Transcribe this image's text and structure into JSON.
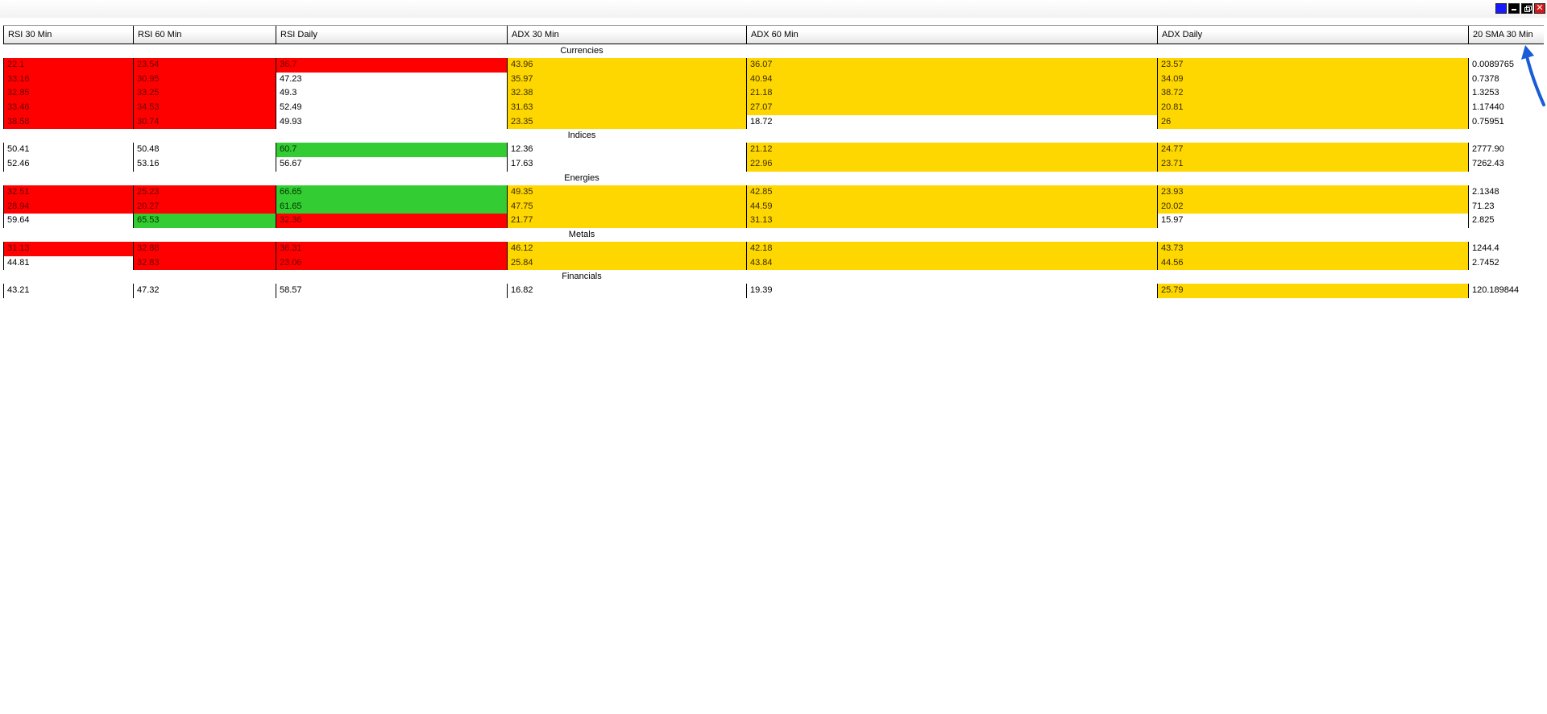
{
  "colors": {
    "red": "#ff0000",
    "green": "#33cc33",
    "yellow": "#ffd700",
    "arrow": "#1a5bd6"
  },
  "titlebar": {
    "buttons": [
      "color-swatch-icon",
      "minimize-icon",
      "restore-icon",
      "close-icon"
    ],
    "close_glyph": "✕"
  },
  "columns": [
    "RSI 30 Min",
    "RSI 60 Min",
    "RSI Daily",
    "ADX 30 Min",
    "ADX 60 Min",
    "ADX Daily",
    "20 SMA 30 Min"
  ],
  "groups": [
    {
      "name": "Currencies",
      "rows": [
        [
          {
            "v": "22.1",
            "c": "red"
          },
          {
            "v": "23.54",
            "c": "red"
          },
          {
            "v": "36.7",
            "c": "red"
          },
          {
            "v": "43.96",
            "c": "yellow"
          },
          {
            "v": "36.07",
            "c": "yellow"
          },
          {
            "v": "23.57",
            "c": "yellow"
          },
          {
            "v": "0.0089765",
            "c": "white"
          }
        ],
        [
          {
            "v": "33.16",
            "c": "red"
          },
          {
            "v": "30.95",
            "c": "red"
          },
          {
            "v": "47.23",
            "c": "white"
          },
          {
            "v": "35.97",
            "c": "yellow"
          },
          {
            "v": "40.94",
            "c": "yellow"
          },
          {
            "v": "34.09",
            "c": "yellow"
          },
          {
            "v": "0.7378",
            "c": "white"
          }
        ],
        [
          {
            "v": "32.85",
            "c": "red"
          },
          {
            "v": "33.25",
            "c": "red"
          },
          {
            "v": "49.3",
            "c": "white"
          },
          {
            "v": "32.38",
            "c": "yellow"
          },
          {
            "v": "21.18",
            "c": "yellow"
          },
          {
            "v": "38.72",
            "c": "yellow"
          },
          {
            "v": "1.3253",
            "c": "white"
          }
        ],
        [
          {
            "v": "33.46",
            "c": "red"
          },
          {
            "v": "34.53",
            "c": "red"
          },
          {
            "v": "52.49",
            "c": "white"
          },
          {
            "v": "31.63",
            "c": "yellow"
          },
          {
            "v": "27.07",
            "c": "yellow"
          },
          {
            "v": "20.81",
            "c": "yellow"
          },
          {
            "v": "1.17440",
            "c": "white"
          }
        ],
        [
          {
            "v": "38.58",
            "c": "red"
          },
          {
            "v": "30.74",
            "c": "red"
          },
          {
            "v": "49.93",
            "c": "white"
          },
          {
            "v": "23.35",
            "c": "yellow"
          },
          {
            "v": "18.72",
            "c": "white"
          },
          {
            "v": "26",
            "c": "yellow"
          },
          {
            "v": "0.75951",
            "c": "white"
          }
        ]
      ]
    },
    {
      "name": "Indices",
      "rows": [
        [
          {
            "v": "50.41",
            "c": "white"
          },
          {
            "v": "50.48",
            "c": "white"
          },
          {
            "v": "60.7",
            "c": "green"
          },
          {
            "v": "12.36",
            "c": "white"
          },
          {
            "v": "21.12",
            "c": "yellow"
          },
          {
            "v": "24.77",
            "c": "yellow"
          },
          {
            "v": "2777.90",
            "c": "white"
          }
        ],
        [
          {
            "v": "52.46",
            "c": "white"
          },
          {
            "v": "53.16",
            "c": "white"
          },
          {
            "v": "56.67",
            "c": "white"
          },
          {
            "v": "17.63",
            "c": "white"
          },
          {
            "v": "22.96",
            "c": "yellow"
          },
          {
            "v": "23.71",
            "c": "yellow"
          },
          {
            "v": "7262.43",
            "c": "white"
          }
        ]
      ]
    },
    {
      "name": "Energies",
      "rows": [
        [
          {
            "v": "32.51",
            "c": "red"
          },
          {
            "v": "25.23",
            "c": "red"
          },
          {
            "v": "66.65",
            "c": "green"
          },
          {
            "v": "49.35",
            "c": "yellow"
          },
          {
            "v": "42.85",
            "c": "yellow"
          },
          {
            "v": "23.93",
            "c": "yellow"
          },
          {
            "v": "2.1348",
            "c": "white"
          }
        ],
        [
          {
            "v": "28.94",
            "c": "red"
          },
          {
            "v": "20.27",
            "c": "red"
          },
          {
            "v": "61.65",
            "c": "green"
          },
          {
            "v": "47.75",
            "c": "yellow"
          },
          {
            "v": "44.59",
            "c": "yellow"
          },
          {
            "v": "20.02",
            "c": "yellow"
          },
          {
            "v": "71.23",
            "c": "white"
          }
        ],
        [
          {
            "v": "59.64",
            "c": "white"
          },
          {
            "v": "65.53",
            "c": "green"
          },
          {
            "v": "32.36",
            "c": "red"
          },
          {
            "v": "21.77",
            "c": "yellow"
          },
          {
            "v": "31.13",
            "c": "yellow"
          },
          {
            "v": "15.97",
            "c": "white"
          },
          {
            "v": "2.825",
            "c": "white"
          }
        ]
      ]
    },
    {
      "name": "Metals",
      "rows": [
        [
          {
            "v": "31.13",
            "c": "red"
          },
          {
            "v": "32.88",
            "c": "red"
          },
          {
            "v": "36.31",
            "c": "red"
          },
          {
            "v": "46.12",
            "c": "yellow"
          },
          {
            "v": "42.18",
            "c": "yellow"
          },
          {
            "v": "43.73",
            "c": "yellow"
          },
          {
            "v": "1244.4",
            "c": "white"
          }
        ],
        [
          {
            "v": "44.81",
            "c": "white"
          },
          {
            "v": "32.83",
            "c": "red"
          },
          {
            "v": "23.06",
            "c": "red"
          },
          {
            "v": "25.84",
            "c": "yellow"
          },
          {
            "v": "43.84",
            "c": "yellow"
          },
          {
            "v": "44.56",
            "c": "yellow"
          },
          {
            "v": "2.7452",
            "c": "white"
          }
        ]
      ]
    },
    {
      "name": "Financials",
      "rows": [
        [
          {
            "v": "43.21",
            "c": "white"
          },
          {
            "v": "47.32",
            "c": "white"
          },
          {
            "v": "58.57",
            "c": "white"
          },
          {
            "v": "16.82",
            "c": "white"
          },
          {
            "v": "19.39",
            "c": "white"
          },
          {
            "v": "25.79",
            "c": "yellow"
          },
          {
            "v": "120.189844",
            "c": "white"
          }
        ]
      ]
    }
  ],
  "annotation": {
    "icon": "blue-arrow-icon"
  }
}
